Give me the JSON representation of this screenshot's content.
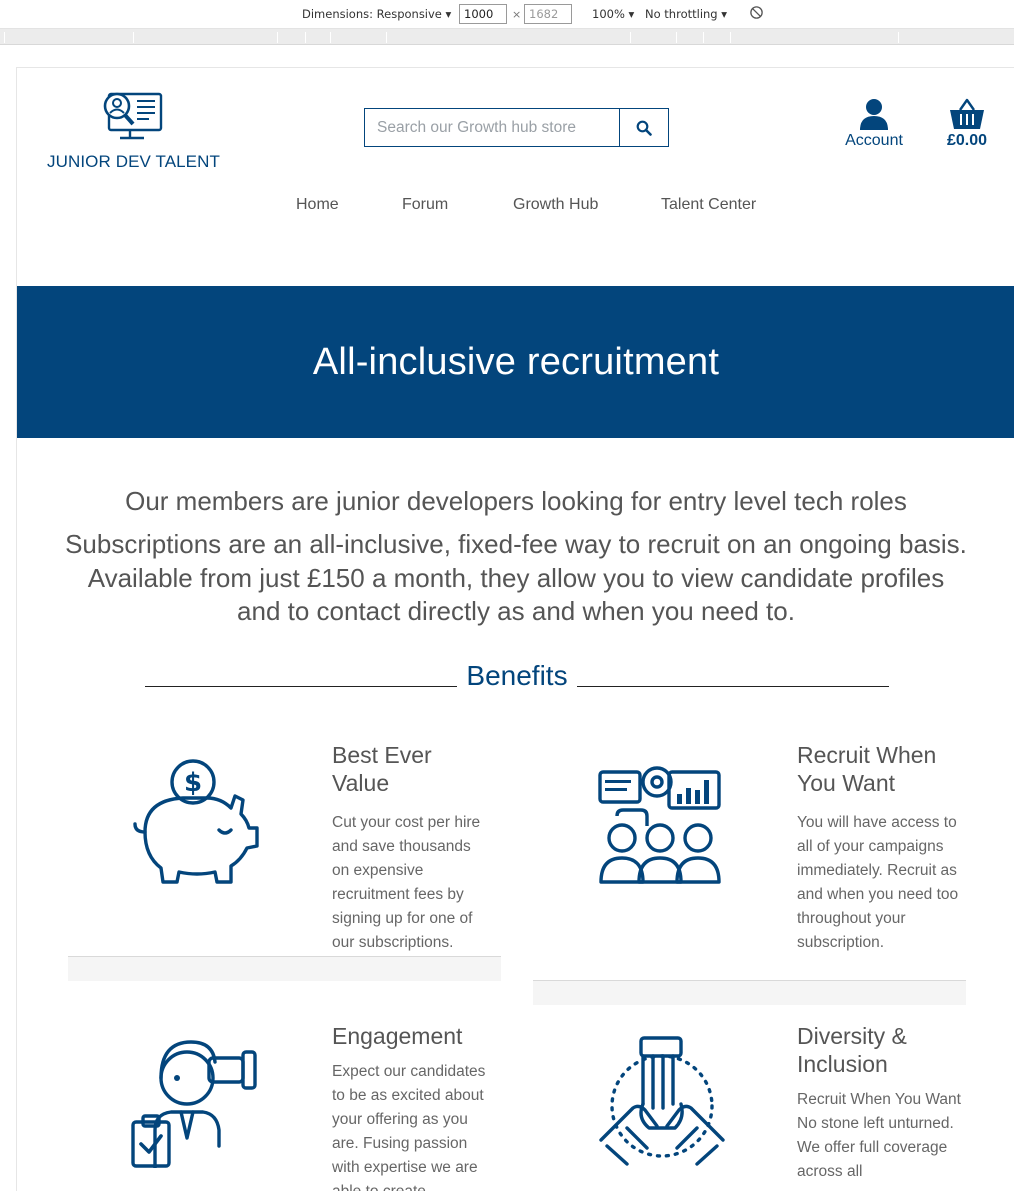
{
  "devtools": {
    "dimensions_label": "Dimensions: Responsive",
    "width_value": "1000",
    "times_symbol": "×",
    "height_value": "1682",
    "zoom": "100%",
    "throttling": "No throttling"
  },
  "header": {
    "logo_text": "JUNIOR DEV TALENT",
    "search_placeholder": "Search our Growth hub store",
    "account_label": "Account",
    "basket_total": "£0.00"
  },
  "nav": {
    "items": [
      "Home",
      "Forum",
      "Growth Hub",
      "Talent Center"
    ]
  },
  "hero": {
    "title": "All-inclusive recruitment"
  },
  "intro": {
    "line1": "Our members are junior developers looking for entry level tech roles",
    "line2": "Subscriptions are an all-inclusive, fixed-fee way to recruit on an ongoing basis. Available from just £150 a month, they allow you to view candidate profiles and to contact directly as and when you need to."
  },
  "benefits": {
    "heading": "Benefits",
    "cards": [
      {
        "icon": "piggy-bank-icon",
        "title": "Best Ever Value",
        "text": "Cut your cost per hire and save thousands on expensive recruitment fees by signing up for one of our subscriptions."
      },
      {
        "icon": "team-dashboard-icon",
        "title": "Recruit When You Want",
        "text": "You will have access to all of your campaigns immediately. Recruit as and when you need too throughout your subscription."
      },
      {
        "icon": "telescope-person-icon",
        "title": "Engagement",
        "text": "Expect our candidates to be as excited about your offering as you are. Fusing passion with expertise we are able to create"
      },
      {
        "icon": "hands-together-icon",
        "title": "Diversity & Inclusion",
        "text": "Recruit When You Want No stone left unturned. We offer full coverage across all"
      }
    ]
  },
  "colors": {
    "brand_blue": "#03457c",
    "text_grey": "#555555"
  }
}
